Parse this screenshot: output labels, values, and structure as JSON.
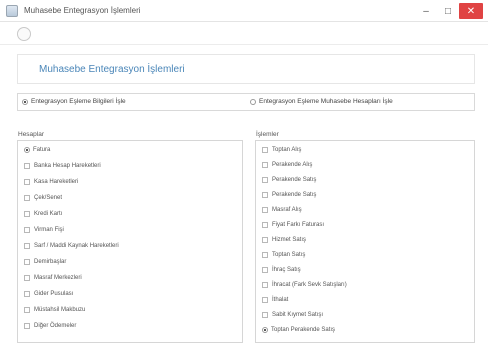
{
  "window": {
    "title": "Muhasebe Entegrasyon İşlemleri",
    "minimize": "–",
    "maximize": "□",
    "close": "✕"
  },
  "header": {
    "title": "Muhasebe Entegrasyon İşlemleri"
  },
  "mode": {
    "options": [
      {
        "label": "Entegrasyon Eşleme Bilgileri İşle",
        "selected": true
      },
      {
        "label": "Entegrasyon Eşleme Muhasebe Hesapları İşle",
        "selected": false
      }
    ]
  },
  "left_group": {
    "label": "Hesaplar",
    "items": [
      {
        "label": "Fatura",
        "selected": true
      },
      {
        "label": "Banka Hesap Hareketleri",
        "selected": false
      },
      {
        "label": "Kasa Hareketleri",
        "selected": false
      },
      {
        "label": "Çek/Senet",
        "selected": false
      },
      {
        "label": "Kredi Kartı",
        "selected": false
      },
      {
        "label": "Virman Fişi",
        "selected": false
      },
      {
        "label": "Sarf / Maddi Kaynak Hareketleri",
        "selected": false
      },
      {
        "label": "Demirbaşlar",
        "selected": false
      },
      {
        "label": "Masraf Merkezleri",
        "selected": false
      },
      {
        "label": "Gider Pusulası",
        "selected": false
      },
      {
        "label": "Müstahsil Makbuzu",
        "selected": false
      },
      {
        "label": "Diğer Ödemeler",
        "selected": false
      }
    ]
  },
  "right_group": {
    "label": "İşlemler",
    "items": [
      {
        "label": "Toptan Alış",
        "selected": false
      },
      {
        "label": "Perakende Alış",
        "selected": false
      },
      {
        "label": "Perakende Satış",
        "selected": false
      },
      {
        "label": "Perakende Satış",
        "selected": false
      },
      {
        "label": "Masraf Alış",
        "selected": false
      },
      {
        "label": "Fiyat Farkı Faturası",
        "selected": false
      },
      {
        "label": "Hizmet Satış",
        "selected": false
      },
      {
        "label": "Toptan Satış",
        "selected": false
      },
      {
        "label": "İhraç Satış",
        "selected": false
      },
      {
        "label": "İhracat (Fark Sevk Satışları)",
        "selected": false
      },
      {
        "label": "İthalat",
        "selected": false
      },
      {
        "label": "Sabit Kıymet Satışı",
        "selected": false
      },
      {
        "label": "Toptan Perakende Satış",
        "selected": true
      }
    ]
  }
}
